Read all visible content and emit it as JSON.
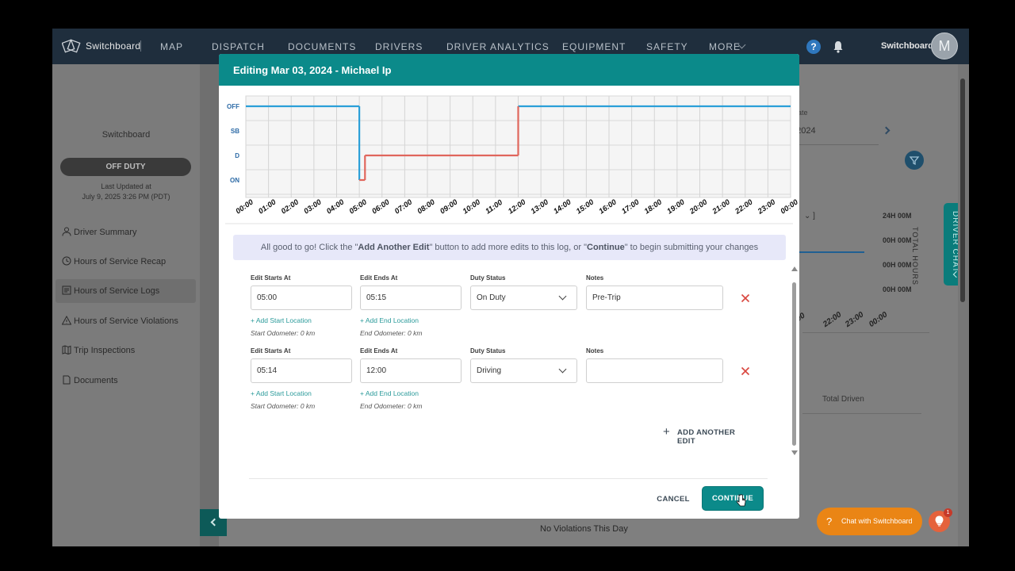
{
  "nav": {
    "logo_text": "Switchboard",
    "items": [
      "MAP",
      "DISPATCH",
      "DOCUMENTS",
      "DRIVERS",
      "DRIVER ANALYTICS",
      "EQUIPMENT",
      "SAFETY",
      "MORE"
    ],
    "help_label": "?",
    "user_name": "Switchboard",
    "avatar_initial": "M"
  },
  "sidebar": {
    "org_name": "Switchboard",
    "duty_status": "OFF DUTY",
    "last_updated_label": "Last Updated at",
    "last_updated_value": "July 9, 2025 3:26 PM (PDT)",
    "items": [
      {
        "label": "Driver Summary",
        "icon": "person-icon"
      },
      {
        "label": "Hours of Service Recap",
        "icon": "clock-icon"
      },
      {
        "label": "Hours of Service Logs",
        "icon": "logbook-icon"
      },
      {
        "label": "Hours of Service Violations",
        "icon": "warning-icon"
      },
      {
        "label": "Trip Inspections",
        "icon": "map-icon"
      },
      {
        "label": "Documents",
        "icon": "document-icon"
      }
    ]
  },
  "background": {
    "date_label": "ate",
    "date_value": ", 2024",
    "select_caret": "]",
    "hours": [
      "24H 00M",
      "00H 00M",
      "00H 00M",
      "00H 00M"
    ],
    "total_hours": "TOTAL HOURS",
    "xticks": [
      "00",
      "22:00",
      "23:00",
      "00:00"
    ],
    "total_driven": "Total Driven",
    "no_violations": "No Violations This Day",
    "driver_chat": "DRIVER CHAT",
    "chat_button": "Chat with Switchboard",
    "bulb_badge": "1"
  },
  "modal": {
    "title": "Editing Mar 03, 2024 - Michael Ip",
    "info": {
      "prefix": "All good to go! Click the \"",
      "add_btn": "Add Another Edit",
      "middle": "\" button to add more edits to this log, or \"",
      "continue": "Continue",
      "suffix": "\" to begin submitting your changes"
    },
    "edits": [
      {
        "starts_label": "Edit Starts At",
        "starts": "05:00",
        "ends_label": "Edit Ends At",
        "ends": "05:15",
        "status_label": "Duty Status",
        "status": "On Duty",
        "notes_label": "Notes",
        "notes": "Pre-Trip",
        "add_start": "+ Add Start Location",
        "add_end": "+ Add End Location",
        "start_odo": "Start Odometer: 0 km",
        "end_odo": "End Odometer: 0 km"
      },
      {
        "starts_label": "Edit Starts At",
        "starts": "05:14",
        "ends_label": "Edit Ends At",
        "ends": "12:00",
        "status_label": "Duty Status",
        "status": "Driving",
        "notes_label": "Notes",
        "notes": "",
        "add_start": "+ Add Start Location",
        "add_end": "+ Add End Location",
        "start_odo": "Start Odometer: 0 km",
        "end_odo": "End Odometer: 0 km"
      }
    ],
    "add_another": "ADD ANOTHER EDIT",
    "cancel": "CANCEL",
    "continue_btn": "CONTINUE"
  },
  "chart_data": {
    "type": "line",
    "title": "",
    "rows": [
      "OFF",
      "SB",
      "D",
      "ON"
    ],
    "x_ticks": [
      "00:00",
      "01:00",
      "02:00",
      "03:00",
      "04:00",
      "05:00",
      "06:00",
      "07:00",
      "08:00",
      "09:00",
      "10:00",
      "11:00",
      "12:00",
      "13:00",
      "14:00",
      "15:00",
      "16:00",
      "17:00",
      "18:00",
      "19:00",
      "20:00",
      "21:00",
      "22:00",
      "23:00",
      "00:00"
    ],
    "xlim": [
      0,
      24
    ],
    "series": [
      {
        "color": "#2a9fd8",
        "segments": [
          [
            0,
            5,
            "OFF"
          ],
          [
            12,
            24,
            "OFF"
          ]
        ],
        "transitions": [
          [
            5,
            "OFF",
            "ON"
          ]
        ]
      },
      {
        "color": "#e0665c",
        "segments": [
          [
            5,
            5.25,
            "ON"
          ],
          [
            5.25,
            12,
            "D"
          ]
        ],
        "transitions": [
          [
            5.25,
            "ON",
            "D"
          ],
          [
            12,
            "D",
            "OFF"
          ]
        ]
      }
    ]
  }
}
